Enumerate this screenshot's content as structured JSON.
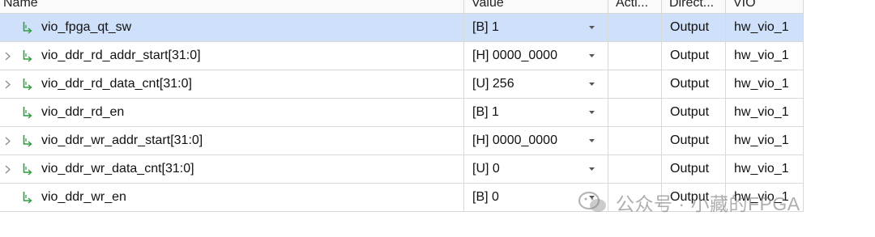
{
  "columns": {
    "name": "Name",
    "value": "Value",
    "activity": "Acti...",
    "direction": "Direct...",
    "vio": "VIO"
  },
  "colors": {
    "selection": "#cfe0fb",
    "probe_icon": "#2e9d3e"
  },
  "rows": [
    {
      "name": "vio_fpga_qt_sw",
      "value": "[B] 1",
      "direction": "Output",
      "vio": "hw_vio_1",
      "expandable": false,
      "selected": true
    },
    {
      "name": "vio_ddr_rd_addr_start[31:0]",
      "value": "[H] 0000_0000",
      "direction": "Output",
      "vio": "hw_vio_1",
      "expandable": true,
      "selected": false
    },
    {
      "name": "vio_ddr_rd_data_cnt[31:0]",
      "value": "[U] 256",
      "direction": "Output",
      "vio": "hw_vio_1",
      "expandable": true,
      "selected": false
    },
    {
      "name": "vio_ddr_rd_en",
      "value": "[B] 1",
      "direction": "Output",
      "vio": "hw_vio_1",
      "expandable": false,
      "selected": false
    },
    {
      "name": "vio_ddr_wr_addr_start[31:0]",
      "value": "[H] 0000_0000",
      "direction": "Output",
      "vio": "hw_vio_1",
      "expandable": true,
      "selected": false
    },
    {
      "name": "vio_ddr_wr_data_cnt[31:0]",
      "value": "[U] 0",
      "direction": "Output",
      "vio": "hw_vio_1",
      "expandable": true,
      "selected": false
    },
    {
      "name": "vio_ddr_wr_en",
      "value": "[B] 0",
      "direction": "Output",
      "vio": "hw_vio_1",
      "expandable": false,
      "selected": false
    }
  ],
  "icons": {
    "expander": "chevron-right-icon",
    "probe": "probe-output-icon",
    "dropdown": "dropdown-arrow-icon"
  },
  "watermark": {
    "text": "公众号 · 小藏的FPGA"
  }
}
